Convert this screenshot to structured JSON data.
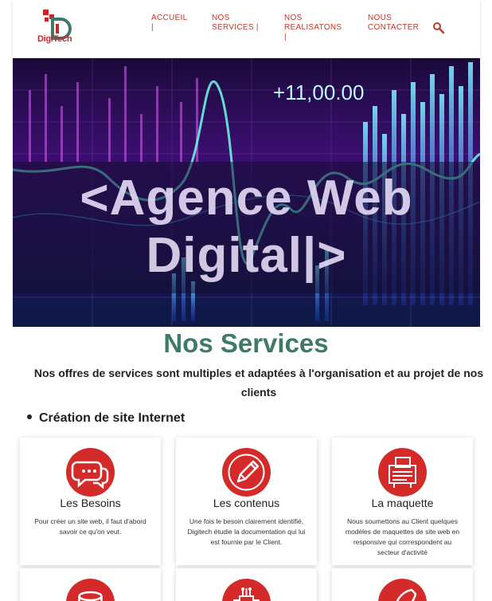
{
  "header": {
    "logo_text": "DigiTech",
    "nav": [
      {
        "label": "ACCUEIL",
        "sep": "|"
      },
      {
        "label": "NOS SERVICES |",
        "sep": ""
      },
      {
        "label": "NOS REALISATONS",
        "sep": "|"
      },
      {
        "label": "NOUS CONTACTER",
        "sep": ""
      }
    ]
  },
  "hero": {
    "title": "<Agence Web Digital|>",
    "ticker": "+11,00.00"
  },
  "services": {
    "title": "Nos Services",
    "subtitle": "Nos offres de services sont multiples et adaptées à l'organisation et au projet de nos clients",
    "category": "Création de site Internet",
    "cards": [
      {
        "title": "Les Besoins",
        "icon": "chat-bubbles-icon",
        "text": "Pour créer un site web, il faut d'abord savoir ce qu'on veut."
      },
      {
        "title": "Les contenus",
        "icon": "pencil-icon",
        "text": "Une fois le besoin clairement identifié, Digitech étudie la documentation qui lui est fournie par le Client."
      },
      {
        "title": "La maquette",
        "icon": "wireframe-icon",
        "text": "Nous soumettons au Client quelques modèles de maquettes de site web en responsive qui correspondent au secteur d'activité"
      },
      {
        "title": "",
        "icon": "database-icon",
        "text": ""
      },
      {
        "title": "",
        "icon": "circuit-icon",
        "text": ""
      },
      {
        "title": "",
        "icon": "rocket-icon",
        "text": ""
      }
    ]
  },
  "colors": {
    "accent": "#c0392b",
    "heading": "#3d7a6a",
    "icon_bg": "#d42a2a"
  }
}
